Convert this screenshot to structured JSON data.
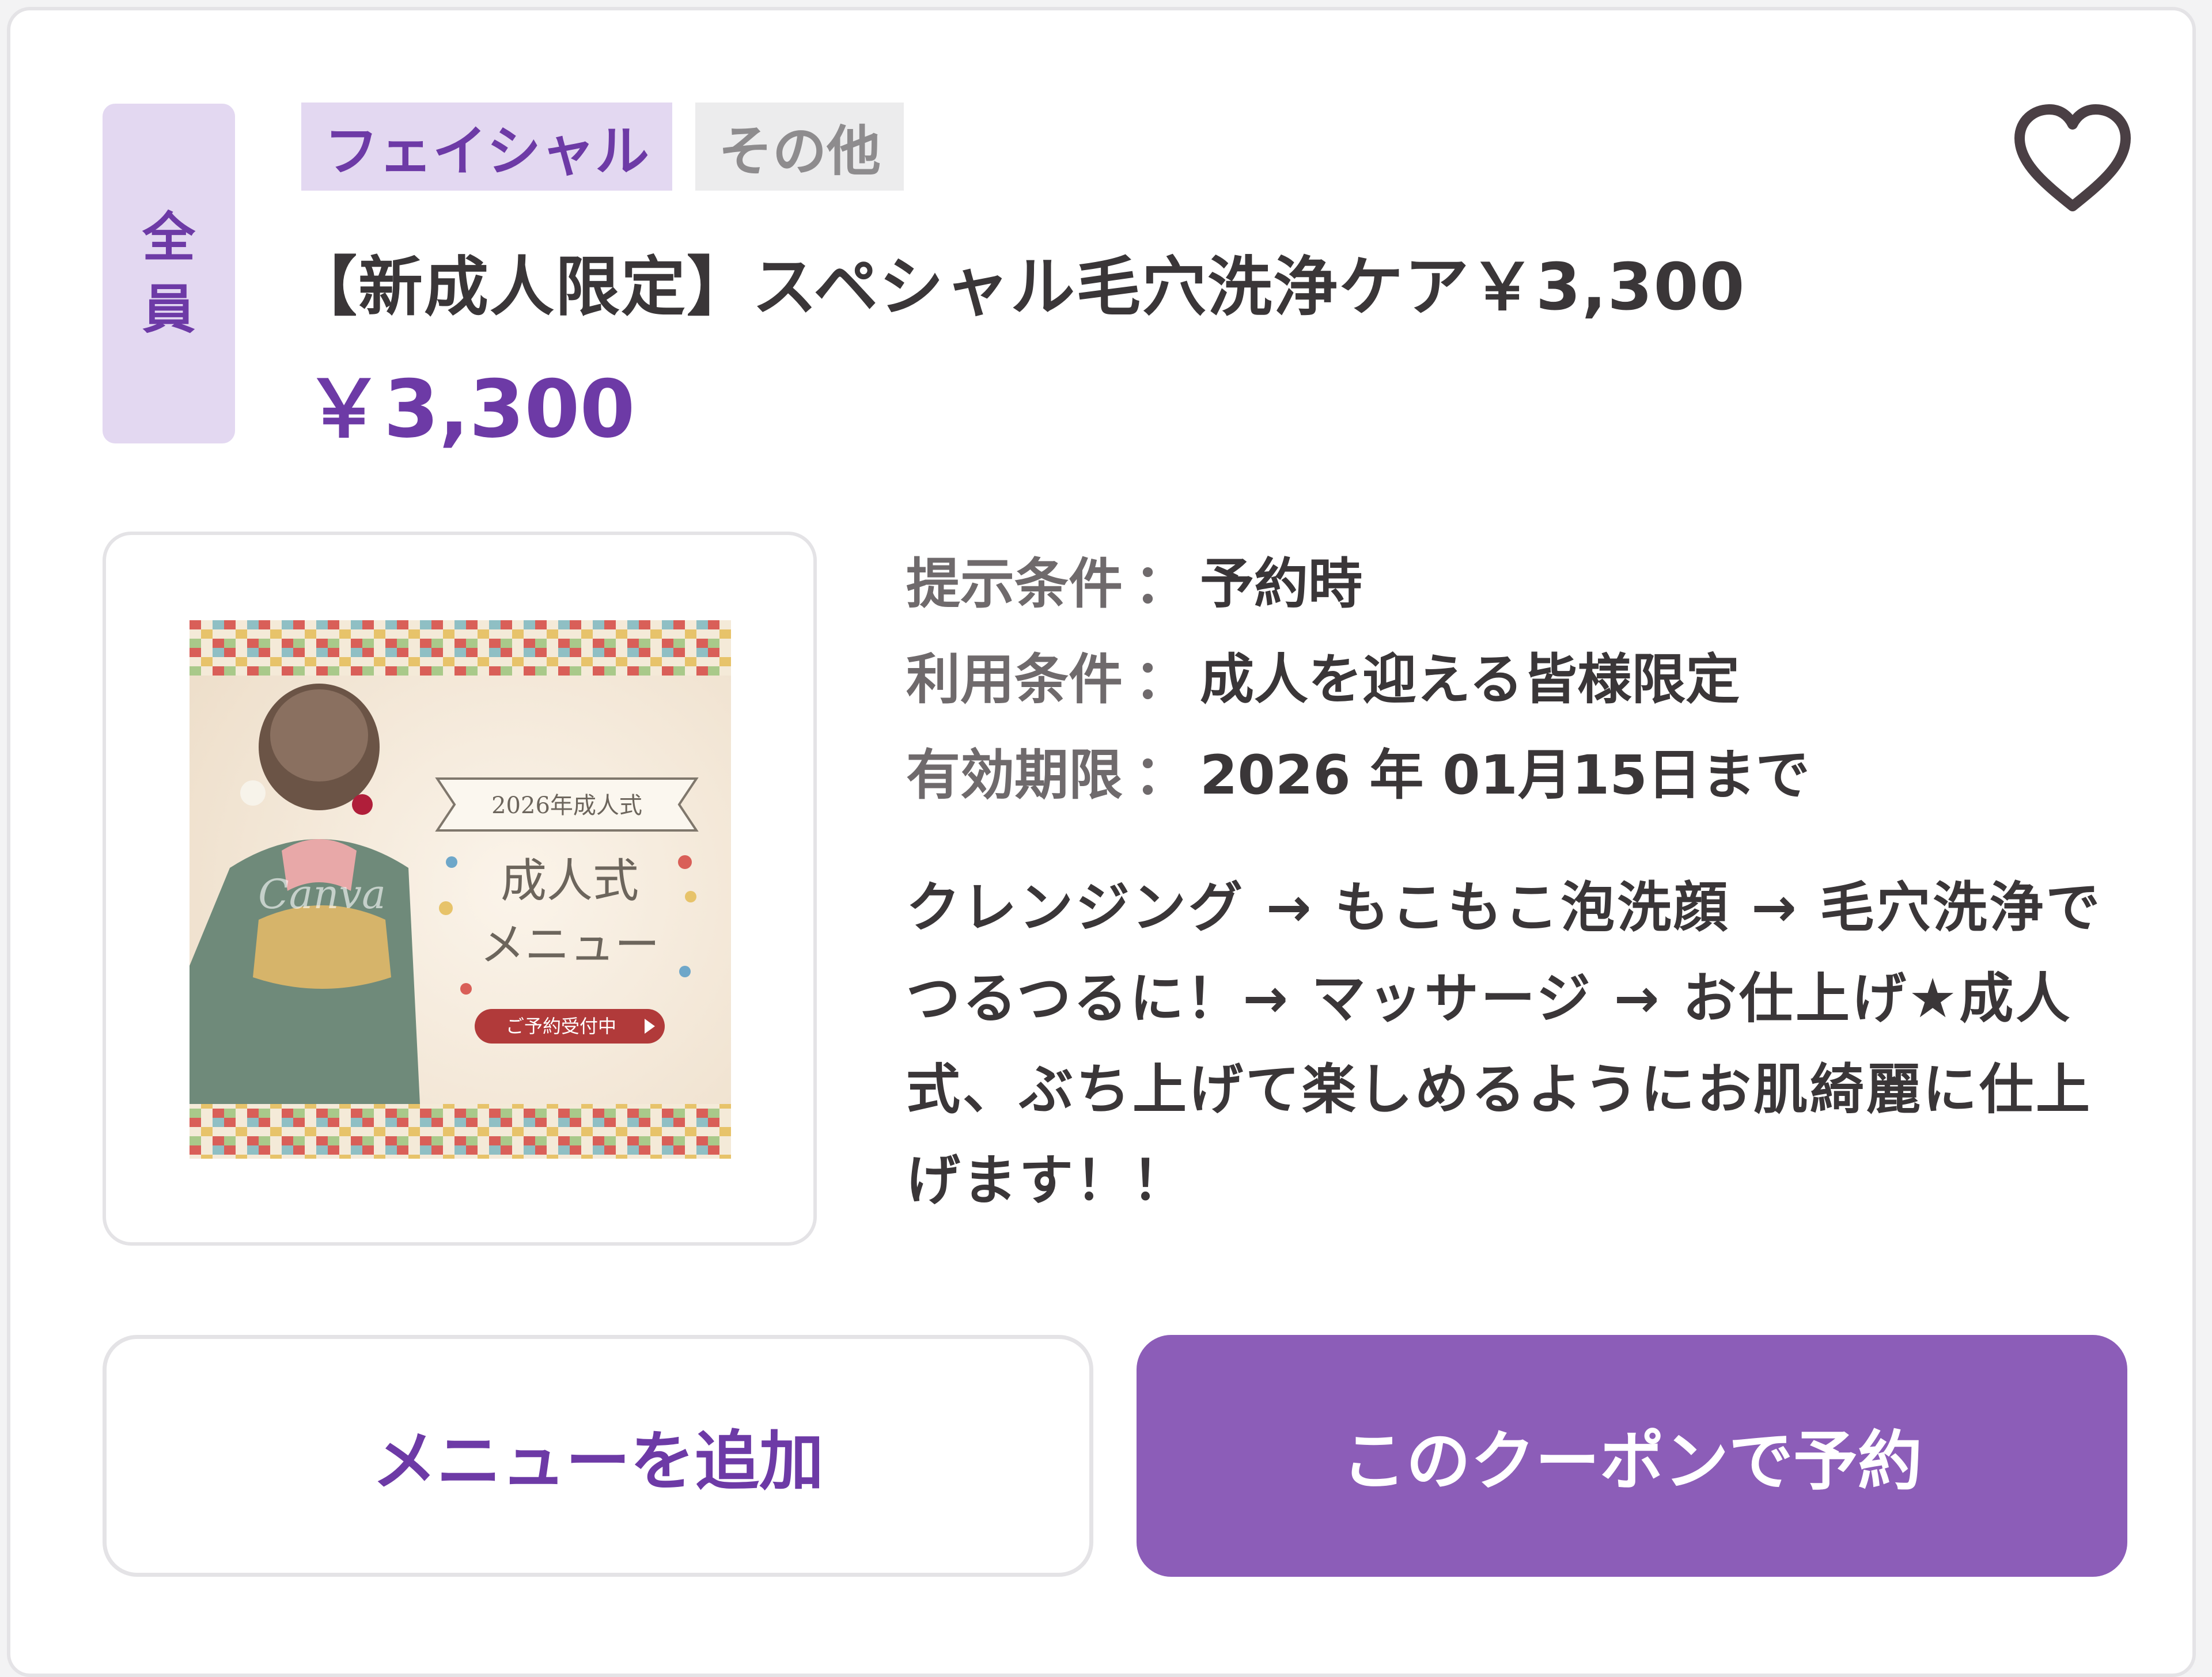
{
  "coupon": {
    "target_badge": [
      "全",
      "員"
    ],
    "tags": [
      "フェイシャル",
      "その他"
    ],
    "title": "【新成人限定】スペシャル毛穴洗浄ケア￥3,300",
    "price": "￥3,300",
    "image": {
      "banner_top": "2026年成人式",
      "heading_line1": "成人式",
      "heading_line2": "メニュー",
      "button": "ご予約受付中",
      "watermark": "Canva"
    },
    "conditions": [
      {
        "label": "提示条件",
        "separator": "：",
        "value": "予約時"
      },
      {
        "label": "利用条件",
        "separator": "：",
        "value": "成人を迎える皆様限定"
      },
      {
        "label": "有効期限",
        "separator": "：",
        "value": "2026 年 01月15日まで"
      }
    ],
    "description": "クレンジング → もこもこ泡洗顔 → 毛穴洗浄でつるつるに！→ マッサージ → お仕上げ★成人式、ぶち上げて楽しめるようにお肌綺麗に仕上げます！！"
  },
  "buttons": {
    "add_menu": "メニューを追加",
    "reserve": "このクーポンで予約"
  },
  "icons": {
    "favorite": "heart-outline-icon"
  },
  "colors": {
    "accent": "#6d3aa6",
    "accent_light": "#e3d8f1",
    "button_primary": "#8c5db8",
    "tag_gray": "#ececed",
    "border": "#e4e3e6"
  }
}
